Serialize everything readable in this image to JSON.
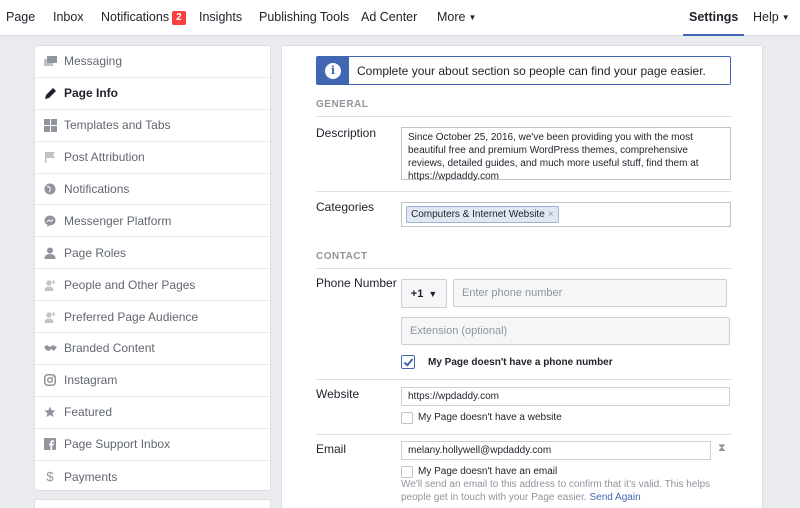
{
  "topnav": {
    "items": [
      {
        "label": "Page"
      },
      {
        "label": "Inbox"
      },
      {
        "label": "Notifications",
        "badge": "2"
      },
      {
        "label": "Insights"
      },
      {
        "label": "Publishing Tools"
      },
      {
        "label": "Ad Center"
      },
      {
        "label": "More"
      },
      {
        "label": "Settings"
      },
      {
        "label": "Help"
      }
    ]
  },
  "sidebar": {
    "items": [
      {
        "label": "Messaging",
        "icon": "message-icon"
      },
      {
        "label": "Page Info",
        "icon": "pencil-icon",
        "active": true
      },
      {
        "label": "Templates and Tabs",
        "icon": "grid-icon"
      },
      {
        "label": "Post Attribution",
        "icon": "flag-icon"
      },
      {
        "label": "Notifications",
        "icon": "globe-icon"
      },
      {
        "label": "Messenger Platform",
        "icon": "messenger-icon"
      },
      {
        "label": "Page Roles",
        "icon": "person-icon"
      },
      {
        "label": "People and Other Pages",
        "icon": "person-plus-icon"
      },
      {
        "label": "Preferred Page Audience",
        "icon": "person-plus-icon"
      },
      {
        "label": "Branded Content",
        "icon": "handshake-icon"
      },
      {
        "label": "Instagram",
        "icon": "instagram-icon"
      },
      {
        "label": "Featured",
        "icon": "star-icon"
      },
      {
        "label": "Page Support Inbox",
        "icon": "facebook-icon"
      },
      {
        "label": "Payments",
        "icon": "dollar-icon"
      }
    ]
  },
  "notice": {
    "text": "Complete your about section so people can find your page easier."
  },
  "general": {
    "title": "GENERAL",
    "description_label": "Description",
    "description_value": "Since October 25, 2016, we've been providing you with the most beautiful free and premium WordPress themes, comprehensive reviews, detailed guides, and much more useful stuff, find them at https://wpdaddy.com",
    "categories_label": "Categories",
    "category_token": "Computers & Internet Website"
  },
  "contact": {
    "title": "CONTACT",
    "phone_label": "Phone Number",
    "country_code": "+1",
    "phone_placeholder": "Enter phone number",
    "extension_placeholder": "Extension (optional)",
    "no_phone_label": "My Page doesn't have a phone number",
    "no_phone_checked": true,
    "website_label": "Website",
    "website_value": "https://wpdaddy.com",
    "no_website_label": "My Page doesn't have a website",
    "email_label": "Email",
    "email_value": "melany.hollywell@wpdaddy.com",
    "no_email_label": "My Page doesn't have an email",
    "email_help": "We'll send an email to this address to confirm that it's valid. This helps people get in touch with your Page easier.",
    "send_again": "Send Again"
  },
  "colors": {
    "accent": "#4267b2",
    "badge": "#fa3e3e",
    "background": "#e9ebee"
  }
}
